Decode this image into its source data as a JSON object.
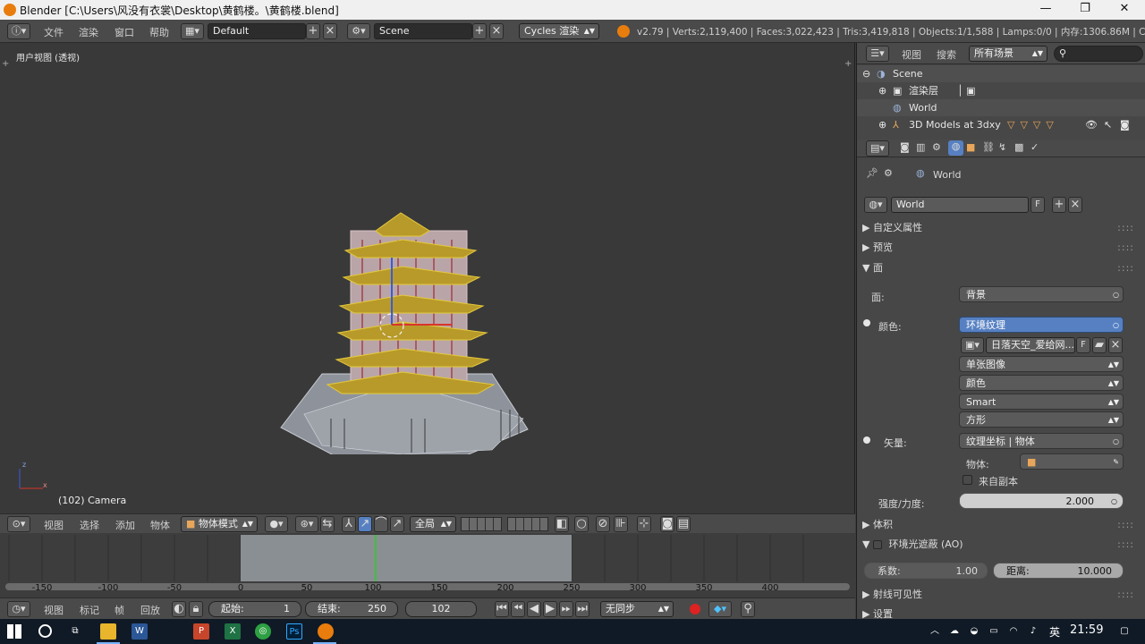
{
  "window": {
    "title": "Blender [C:\\Users\\风没有衣裳\\Desktop\\黄鹤楼。\\黄鹤楼.blend]",
    "minimize": "—",
    "maximize": "❐",
    "close": "✕"
  },
  "infobar": {
    "menus": [
      "文件",
      "渲染",
      "窗口",
      "帮助"
    ],
    "screen_layout": "Default",
    "scene": "Scene",
    "render_engine": "Cycles 渲染",
    "stats": "v2.79 | Verts:2,119,400 | Faces:3,022,423 | Tris:3,419,818 | Objects:1/1,588 | Lamps:0/0 | 内存:1306.86M | Camera"
  },
  "viewport": {
    "view_label": "用户视图 (透视)",
    "frame_object": "(102) Camera",
    "axis_x": "x",
    "axis_z": "z"
  },
  "viewport_toolbar": {
    "menus": [
      "视图",
      "选择",
      "添加",
      "物体"
    ],
    "mode": "物体模式",
    "pivot": "全局"
  },
  "timeline": {
    "ticks": [
      "-150",
      "-100",
      "-50",
      "0",
      "50",
      "100",
      "150",
      "200",
      "250",
      "300",
      "350",
      "400"
    ],
    "menus": [
      "视图",
      "标记",
      "帧",
      "回放"
    ],
    "start_label": "起始:",
    "start_value": "1",
    "end_label": "结束:",
    "end_value": "250",
    "current_frame": "102",
    "sync": "无同步",
    "current_frame_number": 102,
    "range_start": 1,
    "range_end": 250
  },
  "outliner": {
    "menus": [
      "视图",
      "搜索"
    ],
    "display_mode": "所有场景",
    "rows": [
      {
        "label": "Scene"
      },
      {
        "label": "渲染层"
      },
      {
        "label": "World"
      },
      {
        "label": "3D Models at 3dxy"
      }
    ]
  },
  "properties": {
    "breadcrumb": "World",
    "world_name": "World",
    "world_fake_user": "F",
    "panels": {
      "custom_props": "自定义属性",
      "preview": "预览",
      "surface": "面",
      "volume": "体积",
      "ao": "环境光遮蔽 (AO)",
      "ray_visibility": "射线可见性",
      "settings": "设置"
    },
    "surface_label": "面:",
    "surface_value": "背景",
    "color_label": "颜色:",
    "color_value": "环境纹理",
    "image_name": "日落天空_爱给网...",
    "image_fake": "F",
    "image_source": "单张图像",
    "color_space": "颜色",
    "interpolation": "Smart",
    "projection": "方形",
    "vector_label": "矢量:",
    "vector_value": "纹理坐标 | 物体",
    "object_label": "物体:",
    "from_dupli": "来自副本",
    "strength_label": "强度/力度:",
    "strength_value": "2.000",
    "ao_factor_label": "系数:",
    "ao_factor_value": "1.00",
    "ao_distance_label": "距离:",
    "ao_distance_value": "10.000"
  },
  "taskbar": {
    "ime": "英",
    "time": "21:59"
  },
  "colors": {
    "accent_blue": "#5680c2",
    "timeline_range": "#8a8f94",
    "current_frame_line": "#3fbf3f"
  }
}
